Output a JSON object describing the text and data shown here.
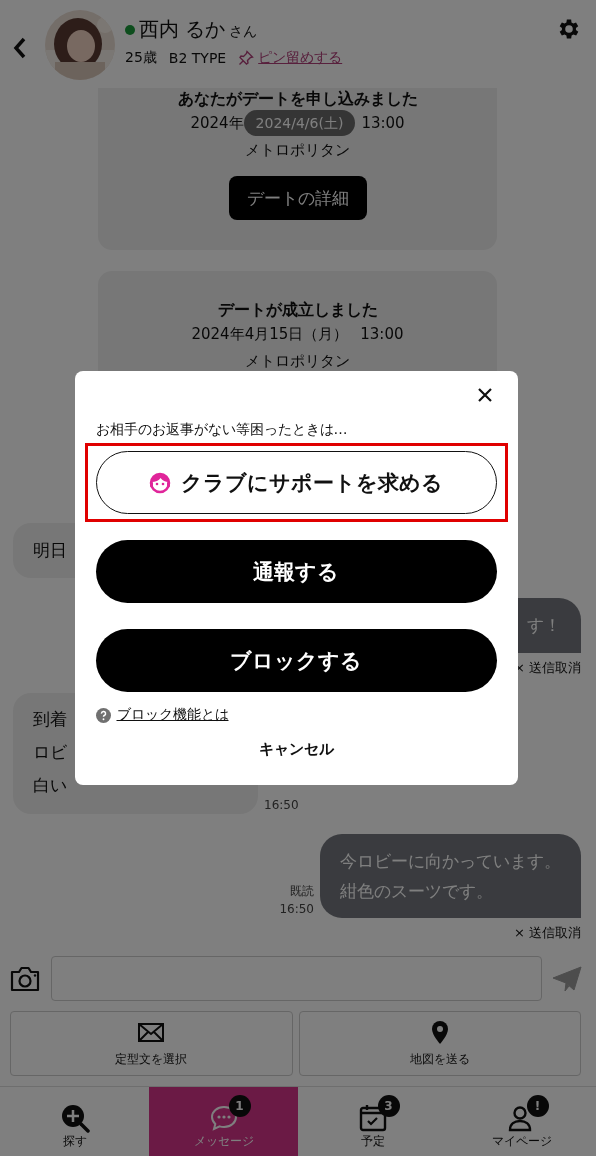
{
  "header": {
    "name": "西内 るか",
    "honorific": "さん",
    "online": true,
    "age": "25歳",
    "type": "B2 TYPE",
    "pin_link": "ピン留めする"
  },
  "chat": {
    "cards": [
      {
        "title": "あなたがデートを申し込みました",
        "date": [
          "2024年",
          "13:00"
        ],
        "date_pill": "2024/4/6(土)",
        "place": "メトロポリタン",
        "button": "デートの詳細"
      },
      {
        "title": "デートが成立しました",
        "date": [
          "2024年4月15日（月）",
          "13:00"
        ],
        "place": "メトロポリタン"
      }
    ],
    "messages": [
      {
        "kind": "received",
        "lines": [
          "明日"
        ]
      },
      {
        "kind": "sent",
        "lines": [
          "す！"
        ],
        "cancel": "× 送信取消"
      },
      {
        "kind": "received",
        "lines": [
          "到着",
          "ロビ",
          "白い"
        ],
        "time": "16:50"
      },
      {
        "kind": "sent",
        "lines": [
          "今ロビーに向かっています。",
          "紺色のスーツです。"
        ],
        "read": "既読",
        "time": "16:50",
        "cancel": "× 送信取消"
      }
    ]
  },
  "composer": {
    "buttons": [
      "定型文を選択",
      "地図を送る"
    ]
  },
  "nav": [
    {
      "label": "探す",
      "selected": false
    },
    {
      "label": "メッセージ",
      "selected": true,
      "badge": "1"
    },
    {
      "label": "予定",
      "selected": false,
      "badge": "3"
    },
    {
      "label": "マイページ",
      "selected": false,
      "badge": "!"
    }
  ],
  "modal": {
    "prompt": "お相手のお返事がない等困ったときは…",
    "actions": [
      {
        "kind": "outline",
        "label": "クラブにサポートを求める",
        "highlighted": true
      },
      {
        "kind": "filled",
        "label": "通報する",
        "highlighted": false
      },
      {
        "kind": "filled",
        "label": "ブロックする",
        "highlighted": false
      }
    ],
    "help_link": "ブロック機能とは",
    "cancel": "キャンセル"
  }
}
